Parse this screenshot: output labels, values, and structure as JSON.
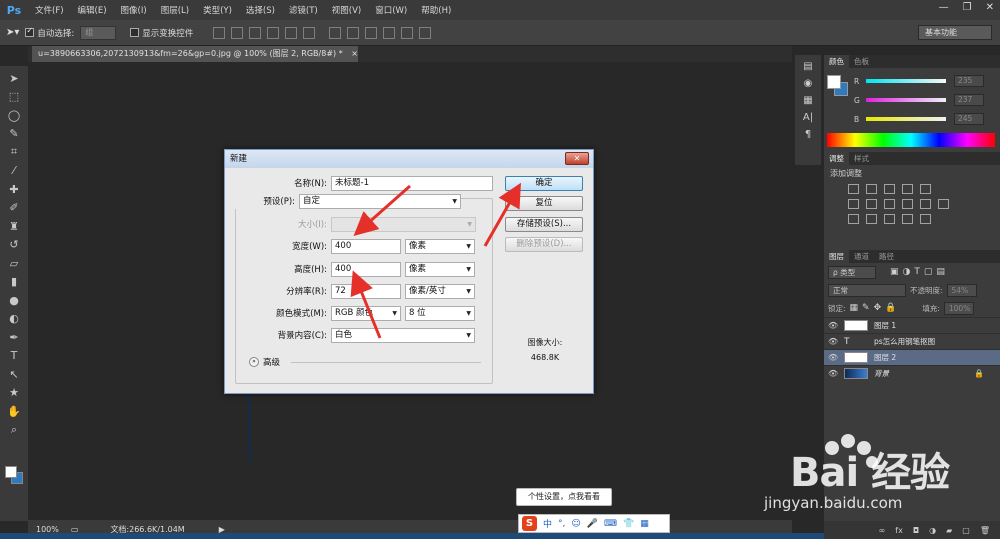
{
  "app": {
    "logo": "Ps"
  },
  "menu": [
    "文件(F)",
    "编辑(E)",
    "图像(I)",
    "图层(L)",
    "类型(Y)",
    "选择(S)",
    "滤镜(T)",
    "视图(V)",
    "窗口(W)",
    "帮助(H)"
  ],
  "window_controls": [
    "—",
    "❐",
    "✕"
  ],
  "options_bar": {
    "auto_select_label": "自动选择:",
    "auto_select_value": "组",
    "show_transform_label": "显示变换控件",
    "workspace": "基本功能"
  },
  "document": {
    "tab_title": "u=3890663306,2072130913&fm=26&gp=0.jpg @ 100% (图层 2, RGB/8#) *",
    "tab_close": "×",
    "zoom": "100%",
    "doc_size": "文档:266.6K/1.04M"
  },
  "panels": {
    "color_tabs": [
      "颜色",
      "色板"
    ],
    "channels": [
      {
        "name": "R",
        "value": "235"
      },
      {
        "name": "G",
        "value": "237"
      },
      {
        "name": "B",
        "value": "245"
      }
    ],
    "adjust_tabs": [
      "调整",
      "样式"
    ],
    "adjust_title": "添加调整",
    "layers_tabs": [
      "图层",
      "通道",
      "路径"
    ],
    "kind_filter": "ρ 类型",
    "blend_mode": "正常",
    "opacity_label": "不透明度:",
    "opacity_value": "54%",
    "lock_label": "锁定:",
    "fill_label": "填充:",
    "fill_value": "100%",
    "layers": [
      {
        "name": "图层 1",
        "type": "image"
      },
      {
        "name": "ps怎么用钢笔抠图",
        "type": "text",
        "glyph": "T"
      },
      {
        "name": "图层 2",
        "type": "image"
      },
      {
        "name": "背景",
        "type": "background"
      }
    ]
  },
  "dialog": {
    "title": "新建",
    "close": "✕",
    "name_label": "名称(N):",
    "name_value": "未标题-1",
    "preset_label": "预设(P):",
    "preset_value": "自定",
    "size_label": "大小(I):",
    "size_value": "",
    "width_label": "宽度(W):",
    "width_value": "400",
    "width_unit": "像素",
    "height_label": "高度(H):",
    "height_value": "400",
    "height_unit": "像素",
    "resolution_label": "分辨率(R):",
    "resolution_value": "72",
    "resolution_unit": "像素/英寸",
    "color_mode_label": "颜色模式(M):",
    "color_mode_value": "RGB 颜色",
    "bit_depth_value": "8 位",
    "bg_contents_label": "背景内容(C):",
    "bg_contents_value": "白色",
    "advanced_label": "高级",
    "ok": "确定",
    "reset": "复位",
    "save_preset": "存储预设(S)...",
    "delete_preset": "删除预设(D)...",
    "image_size_label": "图像大小:",
    "image_size_value": "468.8K"
  },
  "ime": {
    "tooltip": "个性设置，点我看看",
    "logo": "S",
    "mode": "中"
  },
  "watermark": {
    "brand": "Bai  经验",
    "url": "jingyan.baidu.com"
  },
  "colors": {
    "background_swatch": "#2e7bbf",
    "arrow_red": "#e5302a"
  }
}
